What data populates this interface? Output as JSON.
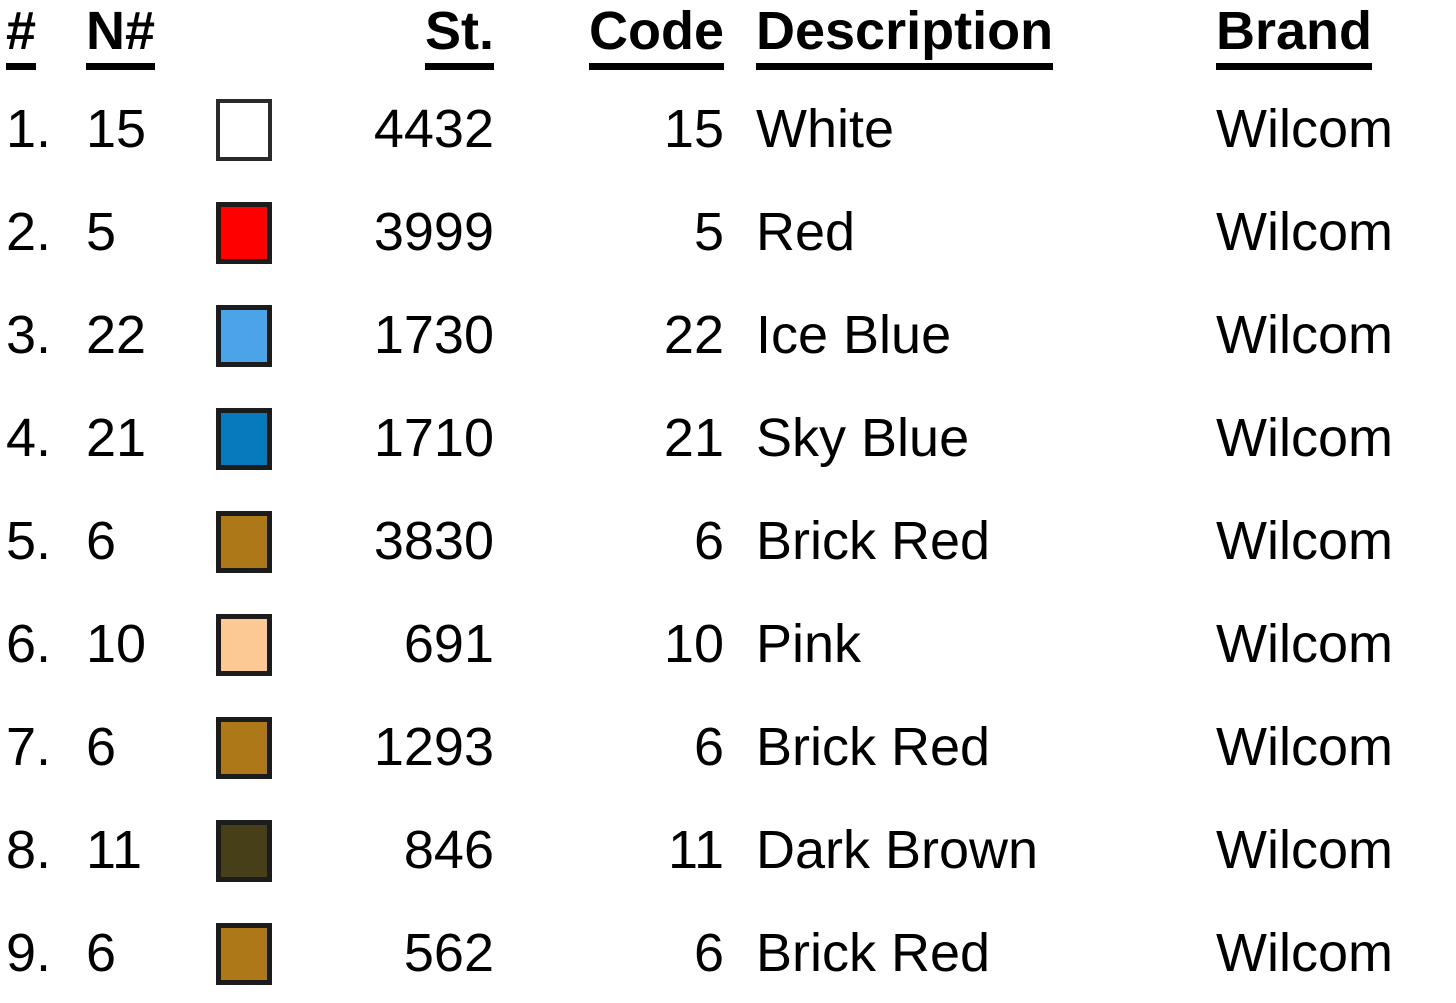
{
  "table": {
    "columns": [
      {
        "key": "num",
        "label": "#",
        "align": "left"
      },
      {
        "key": "nnum",
        "label": "N#",
        "align": "left"
      },
      {
        "key": "swatch",
        "label": "",
        "align": "left"
      },
      {
        "key": "st",
        "label": "St.",
        "align": "right"
      },
      {
        "key": "code",
        "label": "Code",
        "align": "right"
      },
      {
        "key": "desc",
        "label": "Description",
        "align": "left"
      },
      {
        "key": "brand",
        "label": "Brand",
        "align": "left"
      }
    ],
    "headers": {
      "num": "#",
      "nnum": "N#",
      "swatch": "",
      "st": "St.",
      "code": "Code",
      "desc": "Description",
      "brand": "Brand"
    },
    "rows": [
      {
        "num": "1.",
        "nnum": "15",
        "swatch_color": "#FFFFFF",
        "swatch_thin": true,
        "st": "4432",
        "code": "15",
        "desc": "White",
        "brand": "Wilcom"
      },
      {
        "num": "2.",
        "nnum": "5",
        "swatch_color": "#FF0000",
        "swatch_thin": false,
        "st": "3999",
        "code": "5",
        "desc": "Red",
        "brand": "Wilcom"
      },
      {
        "num": "3.",
        "nnum": "22",
        "swatch_color": "#4CA4E8",
        "swatch_thin": false,
        "st": "1730",
        "code": "22",
        "desc": "Ice Blue",
        "brand": "Wilcom"
      },
      {
        "num": "4.",
        "nnum": "21",
        "swatch_color": "#0779BD",
        "swatch_thin": false,
        "st": "1710",
        "code": "21",
        "desc": "Sky Blue",
        "brand": "Wilcom"
      },
      {
        "num": "5.",
        "nnum": "6",
        "swatch_color": "#AD7818",
        "swatch_thin": false,
        "st": "3830",
        "code": "6",
        "desc": "Brick Red",
        "brand": "Wilcom"
      },
      {
        "num": "6.",
        "nnum": "10",
        "swatch_color": "#FCC894",
        "swatch_thin": false,
        "st": "691",
        "code": "10",
        "desc": "Pink",
        "brand": "Wilcom"
      },
      {
        "num": "7.",
        "nnum": "6",
        "swatch_color": "#AD7818",
        "swatch_thin": false,
        "st": "1293",
        "code": "6",
        "desc": "Brick Red",
        "brand": "Wilcom"
      },
      {
        "num": "8.",
        "nnum": "11",
        "swatch_color": "#473F18",
        "swatch_thin": false,
        "st": "846",
        "code": "11",
        "desc": "Dark Brown",
        "brand": "Wilcom"
      },
      {
        "num": "9.",
        "nnum": "6",
        "swatch_color": "#AD7818",
        "swatch_thin": false,
        "st": "562",
        "code": "6",
        "desc": "Brick Red",
        "brand": "Wilcom"
      }
    ]
  },
  "theme": {
    "background": "#FFFFFF",
    "text": "#000000",
    "swatch_border": "#1C1C1C",
    "header_rule": "#000000"
  }
}
